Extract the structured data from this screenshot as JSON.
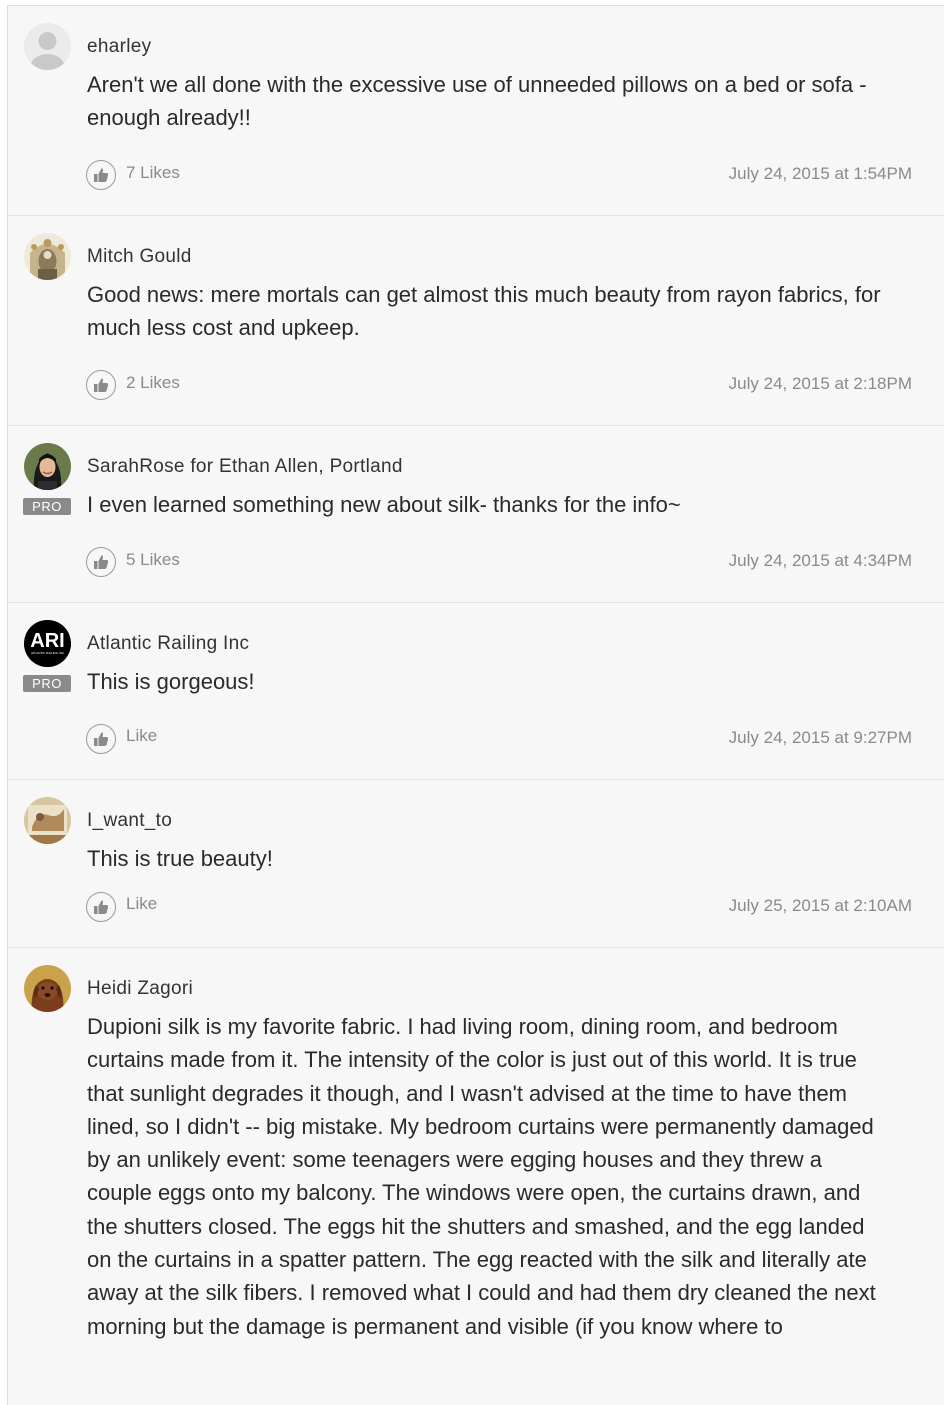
{
  "comments": [
    {
      "author": "eharley",
      "text": "Aren't we all done with the excessive use of unneeded pillows on a bed or sofa - enough already!!",
      "likes": "7 Likes",
      "timestamp": "July 24, 2015 at 1:54PM",
      "pro": false
    },
    {
      "author": "Mitch Gould",
      "text": "Good news: mere mortals can get almost this much beauty from rayon fabrics, for much less cost and upkeep.",
      "likes": "2 Likes",
      "timestamp": "July 24, 2015 at 2:18PM",
      "pro": false
    },
    {
      "author": "SarahRose for Ethan Allen, Portland",
      "text": "I even learned something new about silk- thanks for the info~",
      "likes": "5 Likes",
      "timestamp": "July 24, 2015 at 4:34PM",
      "pro": true,
      "pro_label": "PRO"
    },
    {
      "author": "Atlantic Railing Inc",
      "text": "This is gorgeous!",
      "likes": "Like",
      "timestamp": "July 24, 2015 at 9:27PM",
      "pro": true,
      "pro_label": "PRO",
      "logo_text": "ARI",
      "logo_subtext": "ATLANTIC RAILING INC"
    },
    {
      "author": "I_want_to",
      "text": "This is true beauty!",
      "likes": "Like",
      "timestamp": "July 25, 2015 at 2:10AM",
      "pro": false
    },
    {
      "author": "Heidi Zagori",
      "text": "Dupioni silk is my favorite fabric. I had living room, dining room, and bedroom curtains made from it. The intensity of the color is just out of this world. It is true that sunlight degrades it though, and I wasn't advised at the time to have them lined, so I didn't -- big mistake. My bedroom curtains were permanently damaged by an unlikely event: some teenagers were egging houses and they threw a couple eggs onto my balcony. The windows were open, the curtains drawn, and the shutters closed. The eggs hit the shutters and smashed, and the egg landed on the curtains in a spatter pattern. The egg reacted with the silk and literally ate away at the silk fibers. I removed what I could and had them dry cleaned the next morning but the damage is permanent and visible (if you know where to",
      "pro": false
    }
  ],
  "icons": {
    "like": "thumbs-up-icon",
    "default_avatar": "user-silhouette-icon"
  },
  "colors": {
    "background": "#f7f7f7",
    "muted_text": "#8a8a8a",
    "pro_badge": "#8a8a8a"
  }
}
